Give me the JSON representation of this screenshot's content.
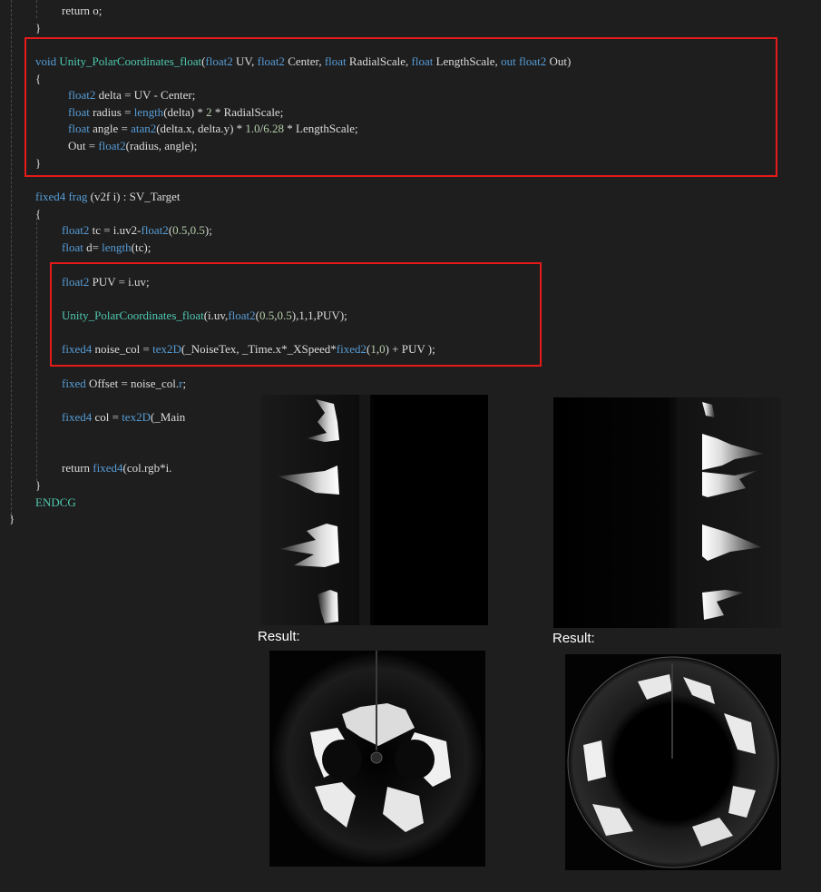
{
  "code": {
    "lines": [
      {
        "parts": [
          {
            "t": "return o;",
            "c": "plain"
          }
        ]
      },
      {
        "parts": [
          {
            "t": "}",
            "c": "plain"
          }
        ]
      },
      {
        "parts": [
          {
            "t": "void",
            "c": "kw"
          },
          {
            "t": " ",
            "c": "plain"
          },
          {
            "t": "Unity_PolarCoordinates_float",
            "c": "fn"
          },
          {
            "t": "(",
            "c": "plain"
          },
          {
            "t": "float2",
            "c": "kw"
          },
          {
            "t": " UV, ",
            "c": "plain"
          },
          {
            "t": "float2",
            "c": "kw"
          },
          {
            "t": " Center, ",
            "c": "plain"
          },
          {
            "t": "float",
            "c": "kw"
          },
          {
            "t": " RadialScale, ",
            "c": "plain"
          },
          {
            "t": "float",
            "c": "kw"
          },
          {
            "t": " LengthScale, ",
            "c": "plain"
          },
          {
            "t": "out",
            "c": "kw"
          },
          {
            "t": " ",
            "c": "plain"
          },
          {
            "t": "float2",
            "c": "kw"
          },
          {
            "t": " Out)",
            "c": "plain"
          }
        ]
      },
      {
        "parts": [
          {
            "t": "{",
            "c": "plain"
          }
        ]
      },
      {
        "parts": [
          {
            "t": "float2",
            "c": "kw"
          },
          {
            "t": " delta = UV - Center;",
            "c": "plain"
          }
        ]
      },
      {
        "parts": [
          {
            "t": "float",
            "c": "kw"
          },
          {
            "t": " radius = ",
            "c": "plain"
          },
          {
            "t": "length",
            "c": "kw"
          },
          {
            "t": "(delta) * ",
            "c": "plain"
          },
          {
            "t": "2",
            "c": "num"
          },
          {
            "t": " * RadialScale;",
            "c": "plain"
          }
        ]
      },
      {
        "parts": [
          {
            "t": "float",
            "c": "kw"
          },
          {
            "t": " angle = ",
            "c": "plain"
          },
          {
            "t": "atan2",
            "c": "kw"
          },
          {
            "t": "(delta.x, delta.y) * ",
            "c": "plain"
          },
          {
            "t": "1.0",
            "c": "num"
          },
          {
            "t": "/",
            "c": "plain"
          },
          {
            "t": "6.28",
            "c": "num"
          },
          {
            "t": " * LengthScale;",
            "c": "plain"
          }
        ]
      },
      {
        "parts": [
          {
            "t": "Out = ",
            "c": "plain"
          },
          {
            "t": "float2",
            "c": "kw"
          },
          {
            "t": "(radius, angle);",
            "c": "plain"
          }
        ]
      },
      {
        "parts": [
          {
            "t": "}",
            "c": "plain"
          }
        ]
      },
      {
        "parts": [
          {
            "t": "fixed4",
            "c": "kw"
          },
          {
            "t": " ",
            "c": "plain"
          },
          {
            "t": "frag",
            "c": "kw"
          },
          {
            "t": " (v2f i) : SV_Target",
            "c": "plain"
          }
        ]
      },
      {
        "parts": [
          {
            "t": "{",
            "c": "plain"
          }
        ]
      },
      {
        "parts": [
          {
            "t": "float2",
            "c": "kw"
          },
          {
            "t": " tc = i.uv2-",
            "c": "plain"
          },
          {
            "t": "float2",
            "c": "kw"
          },
          {
            "t": "(",
            "c": "plain"
          },
          {
            "t": "0.5",
            "c": "num"
          },
          {
            "t": ",",
            "c": "plain"
          },
          {
            "t": "0.5",
            "c": "num"
          },
          {
            "t": ");",
            "c": "plain"
          }
        ]
      },
      {
        "parts": [
          {
            "t": "float",
            "c": "kw"
          },
          {
            "t": " d= ",
            "c": "plain"
          },
          {
            "t": "length",
            "c": "kw"
          },
          {
            "t": "(tc);",
            "c": "plain"
          }
        ]
      },
      {
        "parts": [
          {
            "t": "float2",
            "c": "kw"
          },
          {
            "t": " PUV = i.uv;",
            "c": "plain"
          }
        ]
      },
      {
        "parts": [
          {
            "t": "Unity_PolarCoordinates_float",
            "c": "fn"
          },
          {
            "t": "(i.uv,",
            "c": "plain"
          },
          {
            "t": "float2",
            "c": "kw"
          },
          {
            "t": "(",
            "c": "plain"
          },
          {
            "t": "0.5",
            "c": "num"
          },
          {
            "t": ",",
            "c": "plain"
          },
          {
            "t": "0.5",
            "c": "num"
          },
          {
            "t": "),1,1,PUV);",
            "c": "plain"
          }
        ]
      },
      {
        "parts": [
          {
            "t": "fixed4",
            "c": "kw"
          },
          {
            "t": " noise_col = ",
            "c": "plain"
          },
          {
            "t": "tex2D",
            "c": "kw"
          },
          {
            "t": "(_NoiseTex, _Time.x*_XSpeed*",
            "c": "plain"
          },
          {
            "t": "fixed2",
            "c": "kw"
          },
          {
            "t": "(",
            "c": "plain"
          },
          {
            "t": "1",
            "c": "num"
          },
          {
            "t": ",",
            "c": "plain"
          },
          {
            "t": "0",
            "c": "num"
          },
          {
            "t": ") + PUV );",
            "c": "plain"
          }
        ]
      },
      {
        "parts": [
          {
            "t": "fixed",
            "c": "kw"
          },
          {
            "t": " Offset = noise_col.",
            "c": "plain"
          },
          {
            "t": "r",
            "c": "kw"
          },
          {
            "t": ";",
            "c": "plain"
          }
        ]
      },
      {
        "parts": [
          {
            "t": "fixed4",
            "c": "kw"
          },
          {
            "t": " col = ",
            "c": "plain"
          },
          {
            "t": "tex2D",
            "c": "kw"
          },
          {
            "t": "(_Main",
            "c": "plain"
          }
        ]
      },
      {
        "parts": [
          {
            "t": "return ",
            "c": "plain"
          },
          {
            "t": "fixed4",
            "c": "kw"
          },
          {
            "t": "(col.rgb*i.",
            "c": "plain"
          }
        ]
      },
      {
        "parts": [
          {
            "t": "}",
            "c": "plain"
          }
        ]
      },
      {
        "parts": [
          {
            "t": "ENDCG",
            "c": "mac"
          }
        ]
      },
      {
        "parts": [
          {
            "t": "}",
            "c": "plain"
          }
        ]
      }
    ]
  },
  "results": {
    "left_label": "Result:",
    "right_label": "Result:"
  },
  "colors": {
    "background": "#1e1e1e",
    "keyword": "#569cd6",
    "function": "#4ec9b0",
    "number": "#b5cea8",
    "highlight_box": "#e51a1a"
  }
}
